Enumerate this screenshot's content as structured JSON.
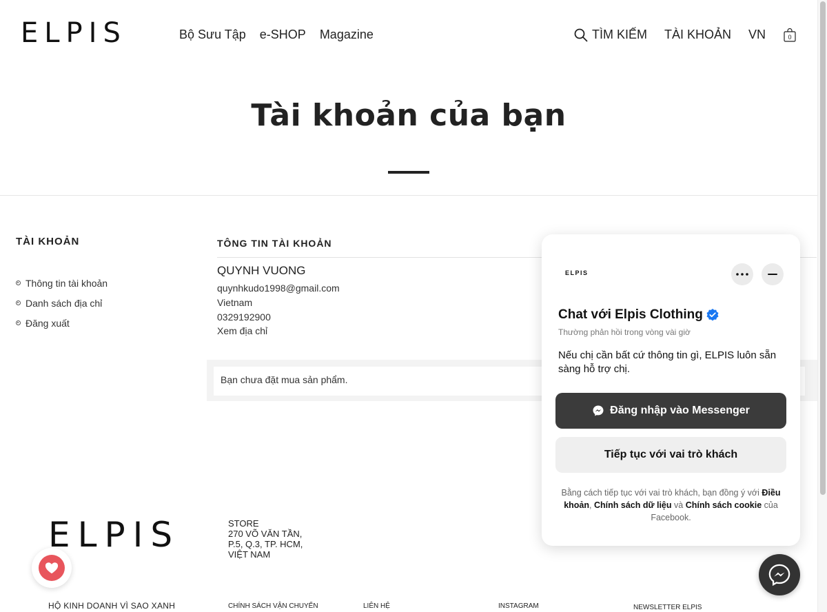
{
  "header": {
    "logo": "ELPIS",
    "nav": [
      "Bộ Sưu Tập",
      "e-SHOP",
      "Magazine"
    ],
    "search_label": "TÌM KIẾM",
    "account_label": "TÀI KHOẢN",
    "lang_label": "VN",
    "cart_count": "0"
  },
  "page": {
    "title": "Tài khoản của bạn"
  },
  "sidebar": {
    "heading": "TÀI KHOẢN",
    "items": [
      "Thông tin tài khoản",
      "Danh sách địa chỉ",
      "Đăng xuất"
    ]
  },
  "account": {
    "heading": "TÔNG TIN TÀI KHOẢN",
    "name": "QUYNH VUONG",
    "email": "quynhkudo1998@gmail.com",
    "country": "Vietnam",
    "phone": "0329192900",
    "address_link": "Xem địa chỉ",
    "orders_empty": "Bạn chưa đặt mua sản phẩm."
  },
  "footer": {
    "logo": "ELPIS",
    "store_label": "STORE",
    "store_address": [
      "270 VÕ VĂN TẦN,",
      "P.5, Q.3, TP. HCM,",
      "VIỆT NAM"
    ],
    "tagline": "HỘ KINH DOANH VÌ SAO XANH",
    "col_shipping": "CHÍNH SÁCH VẬN CHUYỂN",
    "col_contact": "LIÊN HỆ",
    "col_instagram": "INSTAGRAM",
    "col_newsletter": "NEWSLETTER ELPIS"
  },
  "chat": {
    "logo": "ELPIS",
    "title": "Chat với Elpis Clothing",
    "subtitle": "Thường phản hồi trong vòng vài giờ",
    "message": "Nếu chị cần bất cứ thông tin gì, ELPIS luôn sẵn sàng hỗ trợ chị.",
    "login_button": "Đăng nhập vào Messenger",
    "guest_button": "Tiếp tục với vai trò khách",
    "legal_prefix": "Bằng cách tiếp tục với vai trò khách, bạn đồng ý với",
    "legal_terms": "Điều khoản",
    "legal_sep1": ",",
    "legal_data": "Chính sách dữ liệu",
    "legal_and": "và",
    "legal_cookie": "Chính sách cookie",
    "legal_suffix": "của Facebook."
  },
  "colors": {
    "verified": "#1877f2",
    "heart": "#e8555c",
    "dark_button": "#3b3b3b"
  }
}
